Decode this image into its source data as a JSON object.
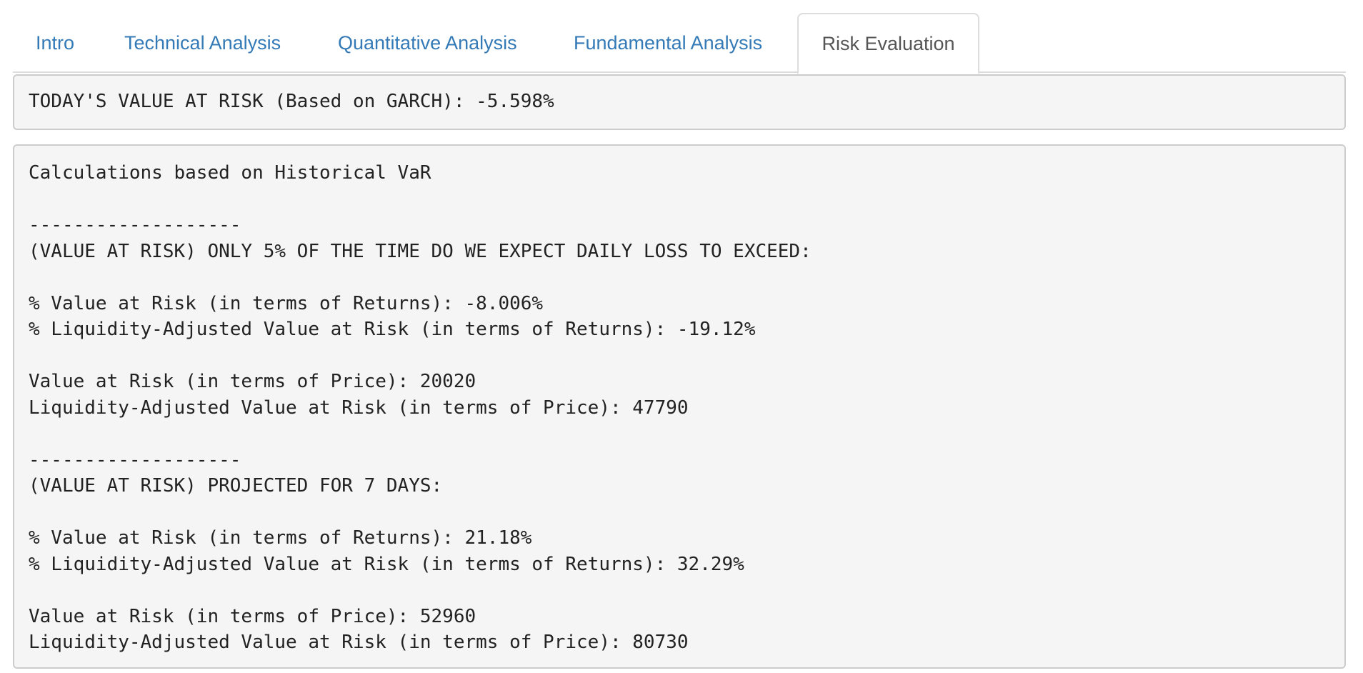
{
  "tabs": [
    {
      "label": "Intro"
    },
    {
      "label": "Technical Analysis"
    },
    {
      "label": "Quantitative Analysis"
    },
    {
      "label": "Fundamental Analysis"
    },
    {
      "label": "Risk Evaluation"
    }
  ],
  "active_tab": "Risk Evaluation",
  "garch": {
    "text": "TODAY'S VALUE AT RISK (Based on GARCH): -5.598%"
  },
  "historical": {
    "text": "Calculations based on Historical VaR\n\n-------------------\n(VALUE AT RISK) ONLY 5% OF THE TIME DO WE EXPECT DAILY LOSS TO EXCEED:\n\n% Value at Risk (in terms of Returns): -8.006%\n% Liquidity-Adjusted Value at Risk (in terms of Returns): -19.12%\n\nValue at Risk (in terms of Price): 20020\nLiquidity-Adjusted Value at Risk (in terms of Price): 47790\n\n-------------------\n(VALUE AT RISK) PROJECTED FOR 7 DAYS:\n\n% Value at Risk (in terms of Returns): 21.18%\n% Liquidity-Adjusted Value at Risk (in terms of Returns): 32.29%\n\nValue at Risk (in terms of Price): 52960\nLiquidity-Adjusted Value at Risk (in terms of Price): 80730"
  },
  "colors": {
    "link": "#337ab7",
    "active_tab_text": "#555555",
    "pre_background": "#f5f5f5",
    "border": "#cccccc"
  }
}
